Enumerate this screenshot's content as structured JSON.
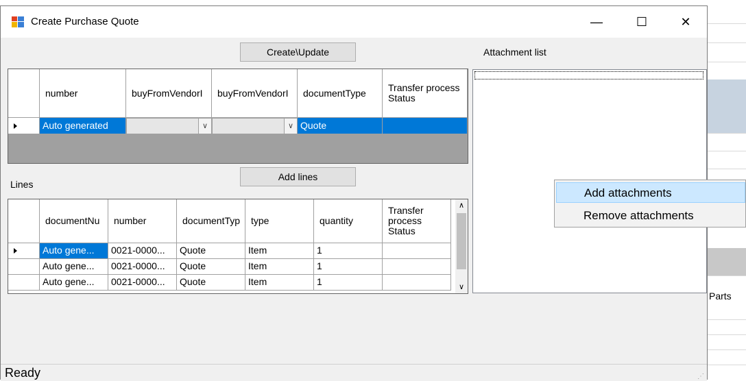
{
  "window": {
    "title": "Create Purchase Quote",
    "minimize": "—",
    "maximize": "☐",
    "close": "✕"
  },
  "buttons": {
    "create_update": "Create\\Update",
    "add_lines": "Add lines"
  },
  "labels": {
    "attachment_list": "Attachment list",
    "lines": "Lines"
  },
  "header_grid": {
    "columns": [
      "number",
      "buyFromVendorI",
      "buyFromVendorI",
      "documentType",
      "Transfer process Status"
    ],
    "row": {
      "number": "Auto generated",
      "documentType": "Quote"
    }
  },
  "lines_grid": {
    "columns": [
      "documentNu",
      "number",
      "documentTyp",
      "type",
      "quantity",
      "Transfer process Status"
    ],
    "rows": [
      [
        "Auto gene...",
        "0021-0000...",
        "Quote",
        "Item",
        "1",
        ""
      ],
      [
        "Auto gene...",
        "0021-0000...",
        "Quote",
        "Item",
        "1",
        ""
      ],
      [
        "Auto gene...",
        "0021-0000...",
        "Quote",
        "Item",
        "1",
        ""
      ]
    ]
  },
  "context_menu": {
    "items": [
      "Add attachments",
      "Remove attachments"
    ]
  },
  "status": {
    "text": "Ready"
  },
  "background_app": {
    "column_label": "Parts"
  },
  "colors": {
    "selection": "#0078d7",
    "menu_highlight": "#cce8ff"
  }
}
